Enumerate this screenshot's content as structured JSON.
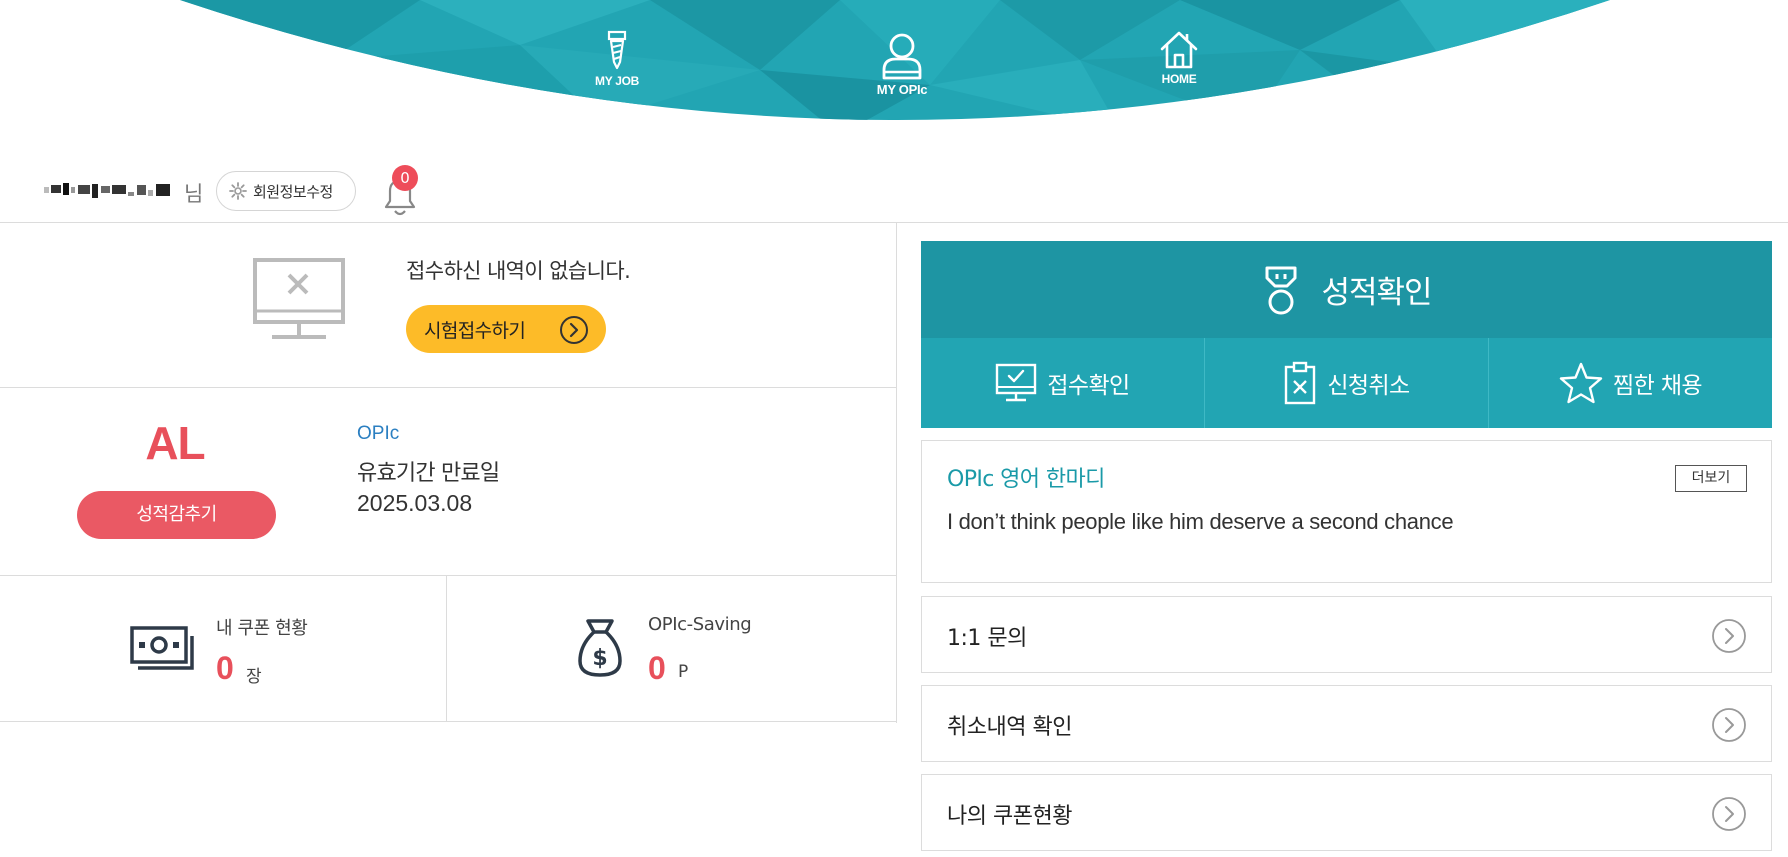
{
  "nav": {
    "items": [
      {
        "label": "MY JOB",
        "icon": "tie-icon"
      },
      {
        "label": "MY OPIc",
        "icon": "user-icon"
      },
      {
        "label": "HOME",
        "icon": "home-icon"
      }
    ]
  },
  "user": {
    "suffix": "님",
    "edit_label": "회원정보수정",
    "notification_count": "0"
  },
  "application": {
    "empty_message": "접수하신 내역이 없습니다.",
    "apply_label": "시험접수하기"
  },
  "grade": {
    "level": "AL",
    "hide_label": "성적감추기",
    "exam_type": "OPIc",
    "valid_label": "유효기간 만료일",
    "valid_date": "2025.03.08"
  },
  "wallet": {
    "coupon_title": "내 쿠폰 현황",
    "coupon_value": "0",
    "coupon_unit": "장",
    "saving_title": "OPIc-Saving",
    "saving_value": "0",
    "saving_unit": "P"
  },
  "right": {
    "header_label": "성적확인",
    "quick_links": [
      {
        "label": "접수확인",
        "icon": "monitor-check-icon"
      },
      {
        "label": "신청취소",
        "icon": "clipboard-x-icon"
      },
      {
        "label": "찜한 채용",
        "icon": "star-icon"
      }
    ],
    "phrase": {
      "title": "OPIc 영어 한마디",
      "more_label": "더보기",
      "text": "I don’t think people like him deserve a second chance"
    },
    "links": [
      {
        "label": "1:1 문의"
      },
      {
        "label": "취소내역 확인"
      },
      {
        "label": "나의 쿠폰현황"
      }
    ]
  },
  "colors": {
    "teal_dark": "#1e95a3",
    "teal": "#22a5b3",
    "accent_red": "#e8505b",
    "accent_yellow": "#fdbb28",
    "link_blue": "#2b7fc1"
  }
}
